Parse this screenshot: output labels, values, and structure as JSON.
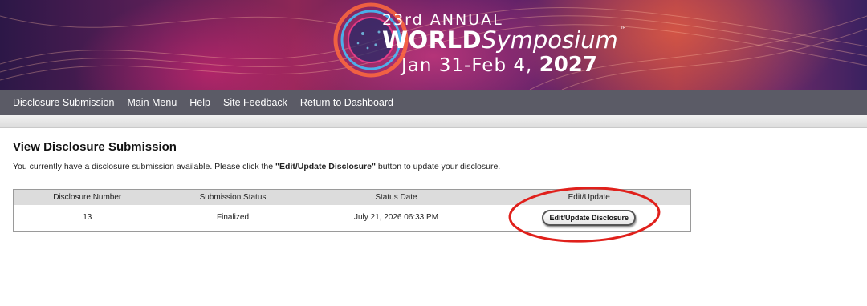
{
  "banner": {
    "line1": "23rd ANNUAL",
    "world": "WORLD",
    "symposium": "Symposium",
    "trademark": "™",
    "dates": "Jan 31-Feb 4,",
    "year": "2027"
  },
  "nav": {
    "items": [
      {
        "label": "Disclosure Submission"
      },
      {
        "label": "Main Menu"
      },
      {
        "label": "Help"
      },
      {
        "label": "Site Feedback"
      },
      {
        "label": "Return to Dashboard"
      }
    ]
  },
  "page": {
    "title": "View Disclosure Submission",
    "desc_before": "You currently have a disclosure submission available. Please click the ",
    "desc_button": "\"Edit/Update Disclosure\"",
    "desc_after": " button to update your disclosure."
  },
  "table": {
    "headers": [
      "Disclosure Number",
      "Submission Status",
      "Status Date",
      "Edit/Update"
    ],
    "rows": [
      {
        "number": "13",
        "status": "Finalized",
        "date": "July 21, 2026 06:33 PM",
        "button_label": "Edit/Update Disclosure"
      }
    ]
  },
  "colors": {
    "nav_background": "#5b5b66",
    "highlight_ring": "#e0201b"
  }
}
